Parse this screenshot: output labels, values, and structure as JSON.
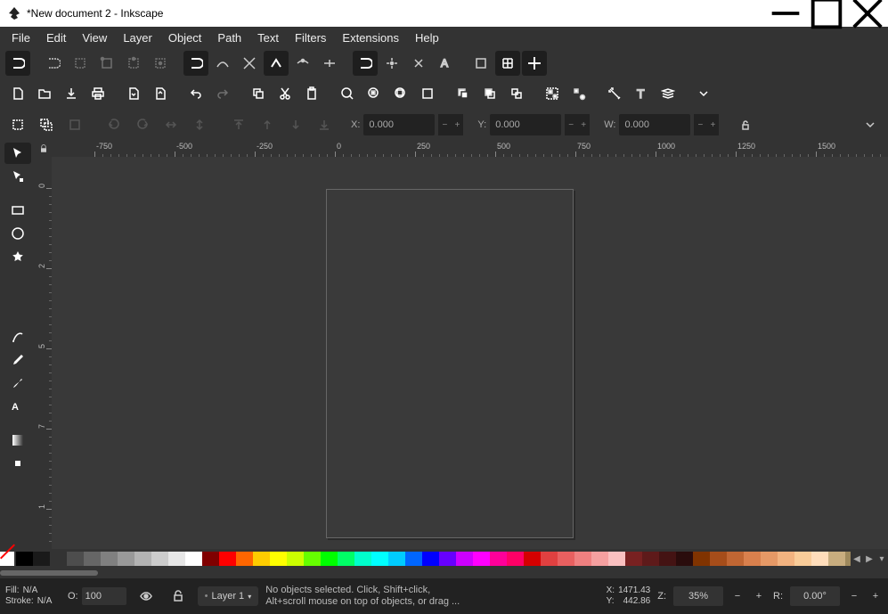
{
  "window": {
    "title": "*New document 2 - Inkscape"
  },
  "menu": [
    "File",
    "Edit",
    "View",
    "Layer",
    "Object",
    "Path",
    "Text",
    "Filters",
    "Extensions",
    "Help"
  ],
  "options": {
    "x_label": "X:",
    "x_val": "0.000",
    "y_label": "Y:",
    "y_val": "0.000",
    "w_label": "W:",
    "w_val": "0.000"
  },
  "ruler_h": [
    "-750",
    "-500",
    "-250",
    "0",
    "250",
    "500",
    "750",
    "1000",
    "1250",
    "1500"
  ],
  "ruler_v": [
    "0",
    "2",
    "5",
    "7",
    "1"
  ],
  "status": {
    "fill_label": "Fill:",
    "fill_val": "N/A",
    "stroke_label": "Stroke:",
    "stroke_val": "N/A",
    "opacity_label": "O:",
    "opacity_val": "100",
    "layer": "Layer 1",
    "msg_line1": "No objects selected. Click, Shift+click,",
    "msg_line2": "Alt+scroll mouse on top of objects, or drag ...",
    "x_label": "X:",
    "x_val": "1471.43",
    "y_label": "Y:",
    "y_val": "442.86",
    "z_label": "Z:",
    "zoom": "35%",
    "r_label": "R:",
    "rot": "0.00°"
  },
  "palette": [
    "#000000",
    "#1a1a1a",
    "#333333",
    "#4d4d4d",
    "#666666",
    "#808080",
    "#999999",
    "#b3b3b3",
    "#cccccc",
    "#e6e6e6",
    "#ffffff",
    "#800000",
    "#ff0000",
    "#ff6600",
    "#ffcc00",
    "#ffff00",
    "#ccff00",
    "#66ff00",
    "#00ff00",
    "#00ff66",
    "#00ffcc",
    "#00ffff",
    "#00ccff",
    "#0066ff",
    "#0000ff",
    "#6600ff",
    "#cc00ff",
    "#ff00ff",
    "#ff0099",
    "#ff0066",
    "#d40000",
    "#e04040",
    "#e86060",
    "#ef8080",
    "#f5a0a0",
    "#fac0c0",
    "#782121",
    "#5e1a1a",
    "#441313",
    "#2a0c0c",
    "#803300",
    "#a64d1a",
    "#c06633",
    "#d9804d",
    "#e69966",
    "#f2b380",
    "#f9cc99",
    "#ffddbb",
    "#c8ad7f",
    "#9e895d"
  ]
}
